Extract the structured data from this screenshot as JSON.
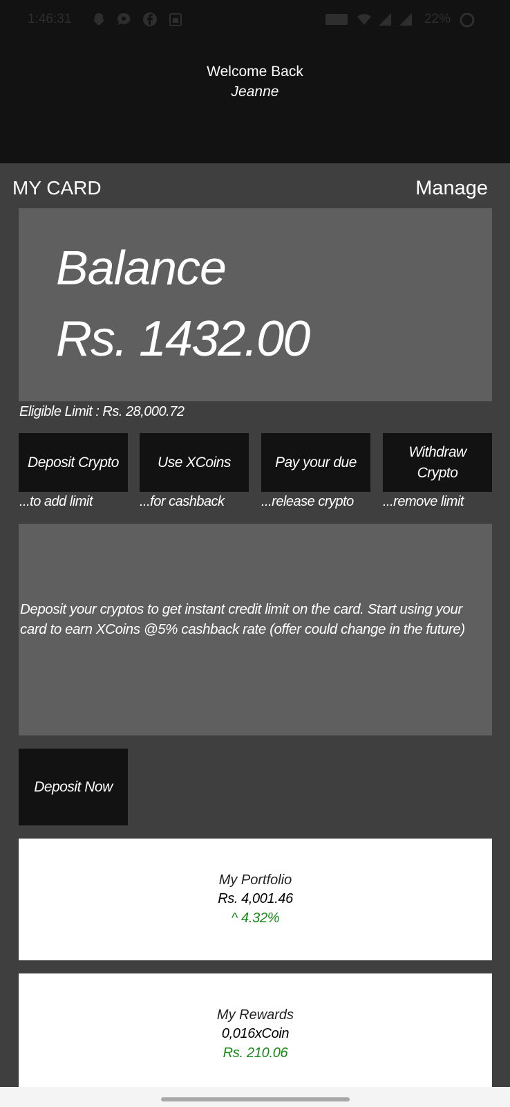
{
  "status_bar": {
    "time": "1:46:31",
    "icons": [
      "snapchat-icon",
      "chat-icon",
      "facebook-icon",
      "calendar-icon",
      "volte-icon",
      "wifi-icon",
      "signal-icon",
      "signal-icon",
      "battery-icon"
    ],
    "battery": "22%"
  },
  "header": {
    "greeting": "Welcome Back",
    "user_name": "Jeanne"
  },
  "card_section": {
    "title": "MY CARD",
    "manage_label": "Manage",
    "balance_label": "Balance",
    "balance_value": "Rs. 1432.00",
    "eligible_limit": "Eligible Limit : Rs. 28,000.72"
  },
  "actions": [
    {
      "label": "Deposit Crypto",
      "sub": "...to add limit"
    },
    {
      "label": "Use XCoins",
      "sub": "...for cashback"
    },
    {
      "label": "Pay your due",
      "sub": "...release crypto"
    },
    {
      "label": "Withdraw Crypto",
      "sub": "...remove limit"
    }
  ],
  "info": {
    "text": "Deposit your cryptos to get instant credit limit on the card. Start using your card to earn XCoins @5% cashback rate (offer could change in the future)"
  },
  "deposit_now_label": "Deposit Now",
  "portfolio": {
    "title": "My Portfolio",
    "value": "Rs. 4,001.46",
    "change": "^ 4.32%"
  },
  "rewards": {
    "title": "My Rewards",
    "value": "0,016xCoin",
    "worth": "Rs. 210.06"
  },
  "colors": {
    "header_bg": "#121212",
    "page_bg": "#3f3f3f",
    "card_bg": "#5f5f5f",
    "button_bg": "#121212",
    "positive_green": "#158a15"
  }
}
